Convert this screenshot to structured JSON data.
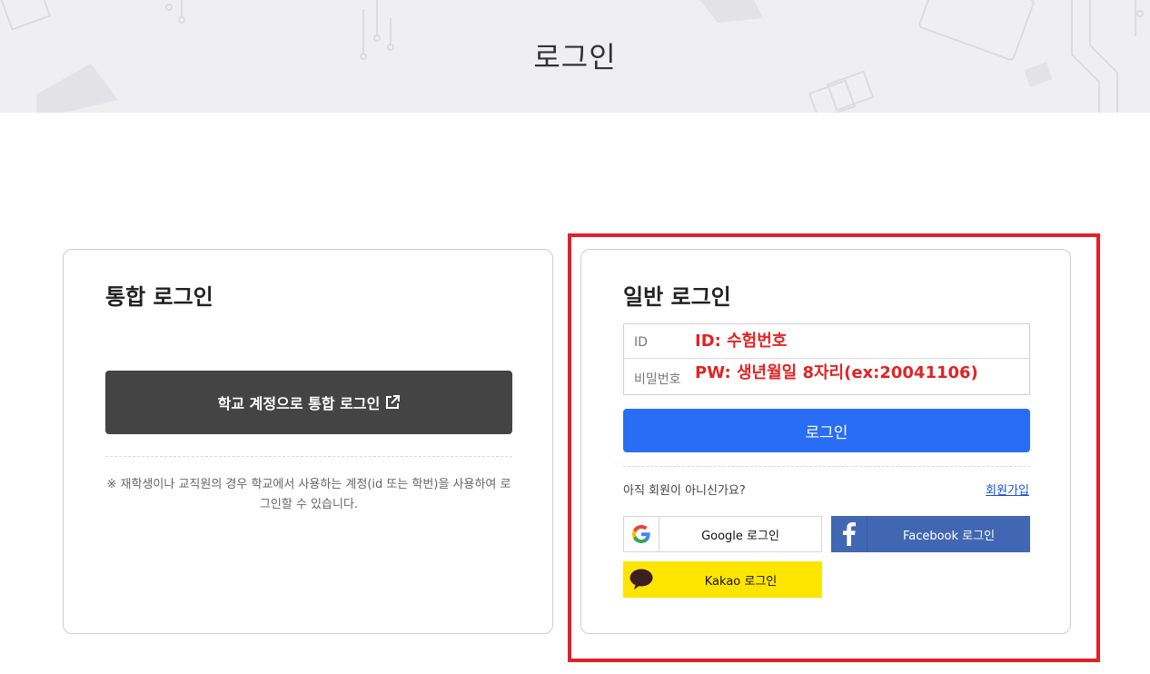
{
  "hero": {
    "title": "로그인"
  },
  "sso_card": {
    "title": "통합 로그인",
    "button_label": "학교 계정으로 통합 로그인",
    "note": "※ 재학생이나 교직원의 경우 학교에서 사용하는 계정(id 또는 학번)을 사용하여 로그인할 수 있습니다."
  },
  "login_card": {
    "title": "일반 로그인",
    "id_label": "ID",
    "id_placeholder": "ID: 수험번호",
    "pw_label": "비밀번호",
    "pw_placeholder": "PW: 생년월일 8자리(ex:20041106)",
    "login_button": "로그인",
    "join_prompt": "아직 회원이 아니신가요?",
    "join_link": "회원가입"
  },
  "social": {
    "google": "Google 로그인",
    "facebook": "Facebook 로그인",
    "kakao": "Kakao 로그인"
  },
  "colors": {
    "primary": "#2a6df5",
    "sso_button": "#444444",
    "facebook": "#4267b2",
    "kakao": "#fee500",
    "highlight": "#e0202a"
  },
  "icons": [
    "external-link-icon",
    "google-icon",
    "facebook-icon",
    "kakao-talk-icon"
  ]
}
